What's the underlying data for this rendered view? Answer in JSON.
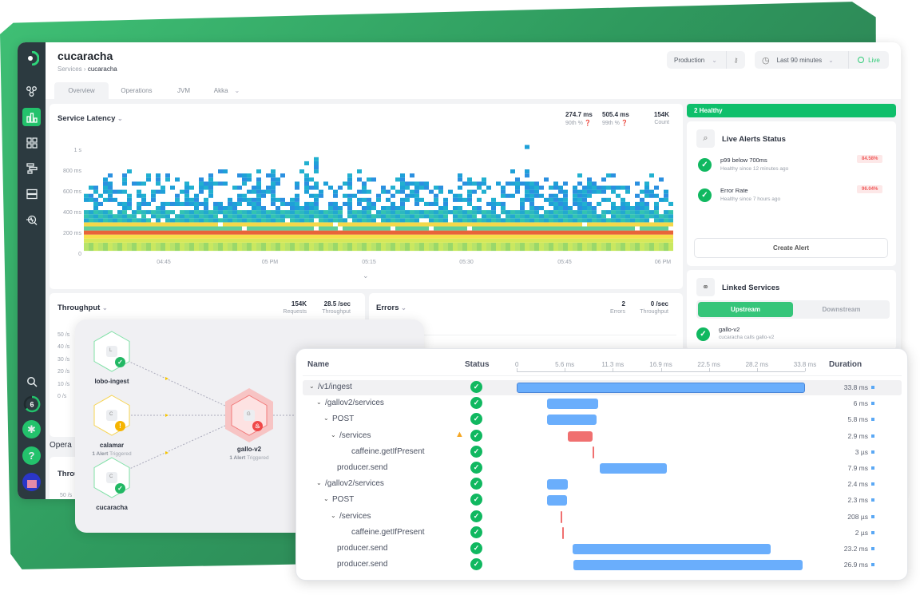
{
  "header": {
    "title": "cucaracha",
    "breadcrumb": [
      "Services",
      "cucaracha"
    ],
    "breadcrumb_sep": "›",
    "environment": "Production",
    "time_range": "Last 90 minutes",
    "live_label": "Live"
  },
  "tabs": [
    {
      "label": "Overview",
      "active": true
    },
    {
      "label": "Operations"
    },
    {
      "label": "JVM"
    },
    {
      "label": "Akka",
      "dropdown": true
    }
  ],
  "sidebar": {
    "icons": [
      "logo-icon",
      "service-map-icon",
      "chart-icon",
      "dashboard-grid-icon",
      "traces-icon",
      "infrastructure-icon",
      "alerts-search-icon"
    ],
    "bottom": [
      "search-icon",
      "progress-ring-icon",
      "bug-icon",
      "help-icon",
      "avatar"
    ],
    "badge_count": "6",
    "help_glyph": "?"
  },
  "latency": {
    "title": "Service Latency",
    "p90": "274.7 ms",
    "p90_label": "90th %",
    "p99": "505.4 ms",
    "p99_label": "99th %",
    "count": "154K",
    "count_label": "Count",
    "y_ticks": [
      "1 s",
      "800 ms",
      "600 ms",
      "400 ms",
      "200 ms",
      "0"
    ],
    "x_ticks": [
      "04:45",
      "05 PM",
      "05:15",
      "05:30",
      "05:45",
      "06 PM"
    ]
  },
  "throughput": {
    "title": "Throughput",
    "requests": "154K",
    "requests_label": "Requests",
    "rate": "28.5 /sec",
    "rate_label": "Throughput",
    "y_ticks": [
      "50 /s",
      "40 /s",
      "30 /s",
      "20 /s",
      "10 /s",
      "0 /s"
    ]
  },
  "errors": {
    "title": "Errors",
    "count": "2",
    "count_label": "Errors",
    "rate": "0 /sec",
    "rate_label": "Throughput"
  },
  "operations_partial": {
    "section": "Opera",
    "card": "Throu",
    "tick": "50 /s"
  },
  "health": {
    "banner": "2 Healthy",
    "color": "#0ebf6b"
  },
  "alerts": {
    "title": "Live Alerts Status",
    "items": [
      {
        "name": "p99 below 700ms",
        "since": "Healthy since 12 minutes ago",
        "value": "84.58%"
      },
      {
        "name": "Error Rate",
        "since": "Healthy since 7 hours ago",
        "value": "96.04%"
      }
    ],
    "create": "Create Alert"
  },
  "linked": {
    "title": "Linked Services",
    "tabs": [
      "Upstream",
      "Downstream"
    ],
    "active": "Upstream",
    "items": [
      {
        "name": "gallo-v2",
        "desc": "cucaracha calls gallo-v2"
      }
    ]
  },
  "service_map": {
    "nodes": [
      {
        "name": "lobo-ingest",
        "letter": "L",
        "status": "healthy"
      },
      {
        "name": "calamar",
        "letter": "C",
        "status": "warning",
        "alerts": "1 Alert",
        "alerts_suffix": "Triggered"
      },
      {
        "name": "cucaracha",
        "letter": "C",
        "status": "healthy"
      },
      {
        "name": "gallo-v2",
        "letter": "G",
        "status": "critical",
        "alerts": "1 Alert",
        "alerts_suffix": "Triggered"
      }
    ]
  },
  "trace": {
    "columns": {
      "name": "Name",
      "status": "Status",
      "duration": "Duration"
    },
    "axis_ticks": [
      "0",
      "5.6 ms",
      "11.3 ms",
      "16.9 ms",
      "22.5 ms",
      "28.2 ms",
      "33.8 ms"
    ],
    "total_ms": 33.8,
    "rows": [
      {
        "name": "/v1/ingest",
        "depth": 0,
        "expand": true,
        "start_ms": 0,
        "dur_ms": 33.8,
        "duration": "33.8 ms",
        "color": "blue"
      },
      {
        "name": "/gallov2/services",
        "depth": 1,
        "expand": true,
        "start_ms": 3.56,
        "dur_ms": 6,
        "duration": "6 ms",
        "color": "blue"
      },
      {
        "name": "POST",
        "depth": 2,
        "expand": true,
        "start_ms": 3.56,
        "dur_ms": 5.8,
        "duration": "5.8 ms",
        "color": "blue"
      },
      {
        "name": "/services",
        "depth": 3,
        "expand": true,
        "warning": true,
        "start_ms": 6.0,
        "dur_ms": 2.9,
        "duration": "2.9 ms",
        "color": "red"
      },
      {
        "name": "caffeine.getIfPresent",
        "depth": 4,
        "start_ms": 8.9,
        "dur_ms": 0.003,
        "duration": "3 µs",
        "color": "red"
      },
      {
        "name": "producer.send",
        "depth": 2,
        "start_ms": 9.74,
        "dur_ms": 7.9,
        "duration": "7.9 ms",
        "color": "blue"
      },
      {
        "name": "/gallov2/services",
        "depth": 1,
        "expand": true,
        "start_ms": 3.56,
        "dur_ms": 2.4,
        "duration": "2.4 ms",
        "color": "blue"
      },
      {
        "name": "POST",
        "depth": 2,
        "expand": true,
        "start_ms": 3.56,
        "dur_ms": 2.3,
        "duration": "2.3 ms",
        "color": "blue"
      },
      {
        "name": "/services",
        "depth": 3,
        "expand": true,
        "start_ms": 5.15,
        "dur_ms": 0.208,
        "duration": "208 µs",
        "color": "red"
      },
      {
        "name": "caffeine.getIfPresent",
        "depth": 4,
        "start_ms": 5.34,
        "dur_ms": 0.002,
        "duration": "2 µs",
        "color": "red"
      },
      {
        "name": "producer.send",
        "depth": 2,
        "start_ms": 6.55,
        "dur_ms": 23.2,
        "duration": "23.2 ms",
        "color": "blue"
      },
      {
        "name": "producer.send",
        "depth": 2,
        "start_ms": 6.65,
        "dur_ms": 26.9,
        "duration": "26.9 ms",
        "color": "blue"
      }
    ]
  },
  "colors": {
    "accent": "#1fbf6a",
    "sidebar": "#2c3a40",
    "bar_blue": "#6aaefc",
    "bar_red": "#f07070",
    "warning": "#f5b400"
  }
}
